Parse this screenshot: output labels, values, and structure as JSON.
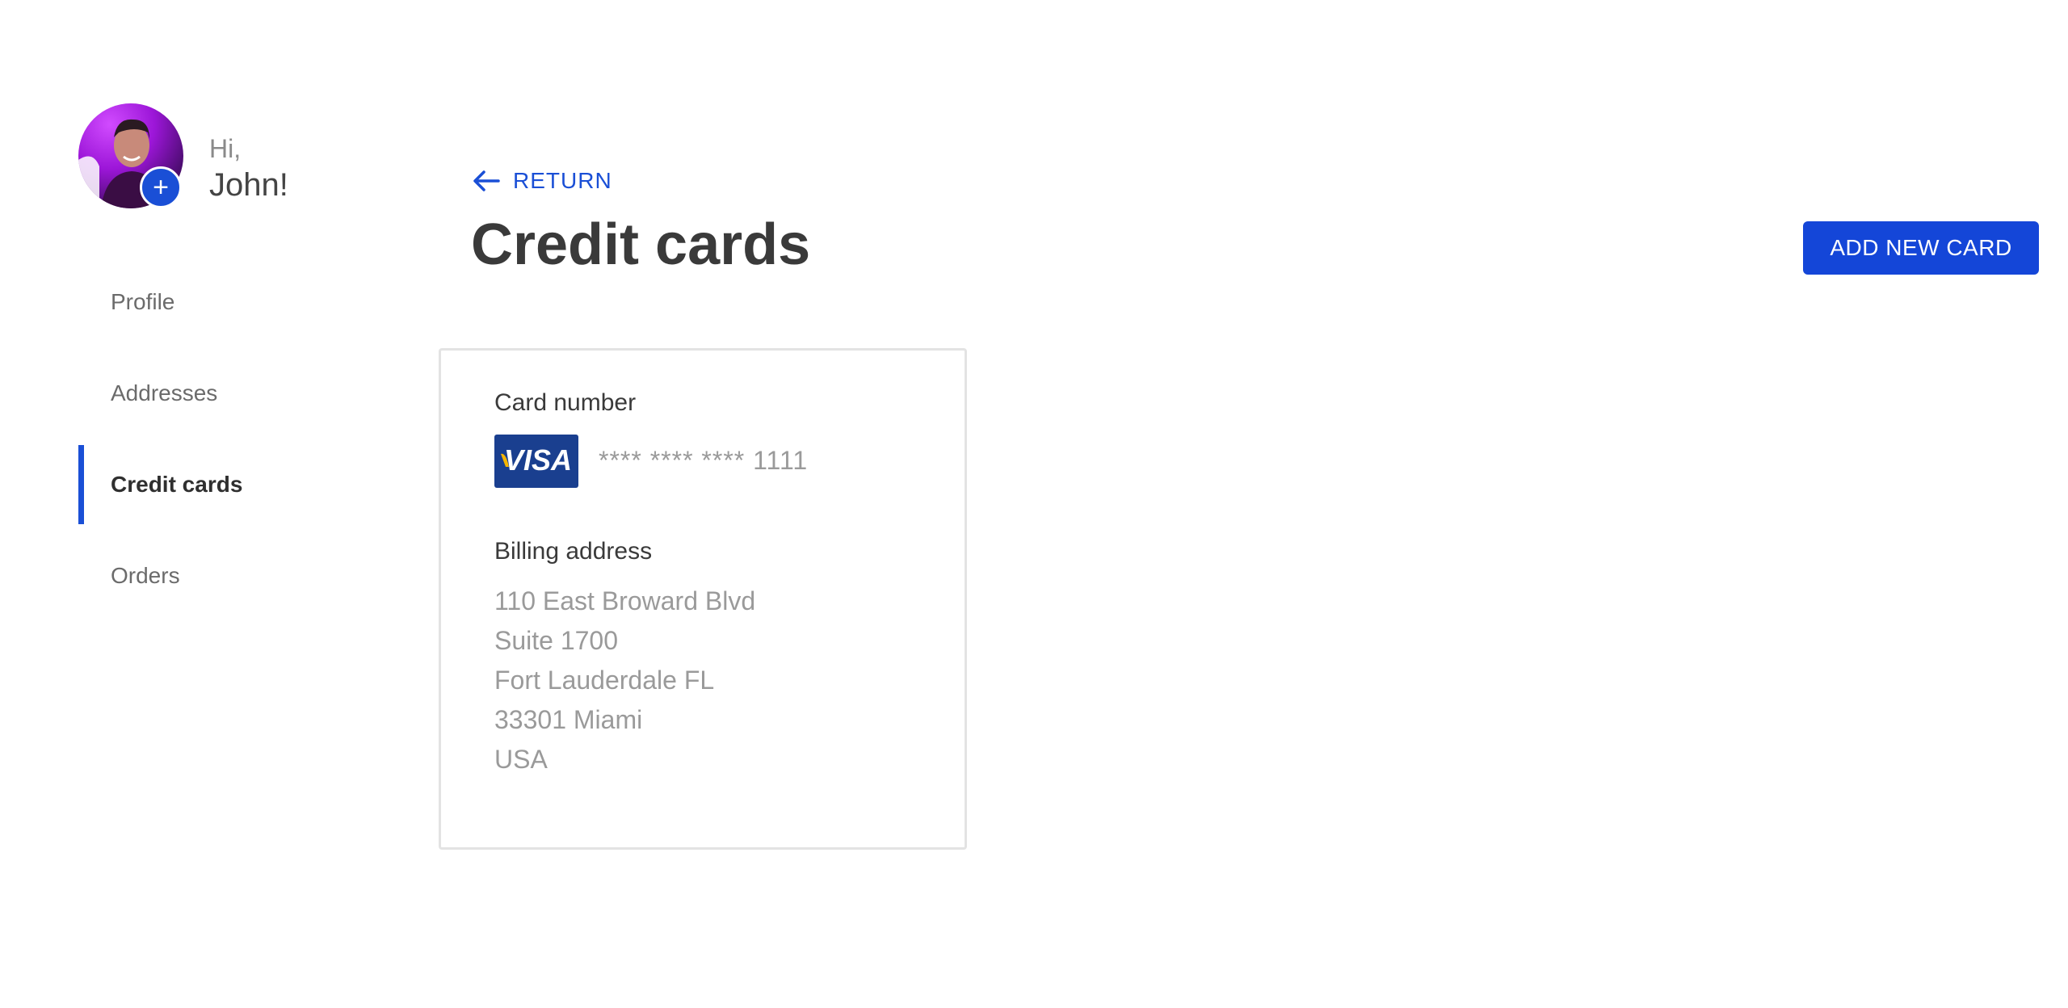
{
  "user": {
    "greeting": "Hi,",
    "name": "John!",
    "add_photo_icon": "plus-icon"
  },
  "sidebar": {
    "items": [
      {
        "label": "Profile",
        "active": false
      },
      {
        "label": "Addresses",
        "active": false
      },
      {
        "label": "Credit cards",
        "active": true
      },
      {
        "label": "Orders",
        "active": false
      }
    ]
  },
  "header": {
    "return_label": "RETURN",
    "return_icon": "arrow-left-icon",
    "title": "Credit cards",
    "add_button_label": "ADD NEW CARD"
  },
  "card": {
    "number_label": "Card number",
    "brand": "VISA",
    "masked_number": "**** **** **** 1111",
    "billing_label": "Billing address",
    "address": [
      "110 East Broward Blvd",
      "Suite 1700",
      "Fort Lauderdale FL",
      "33301 Miami",
      "USA"
    ]
  },
  "colors": {
    "accent": "#1a4fd6",
    "visa_blue": "#1a3f8f",
    "visa_gold": "#f7b600"
  }
}
